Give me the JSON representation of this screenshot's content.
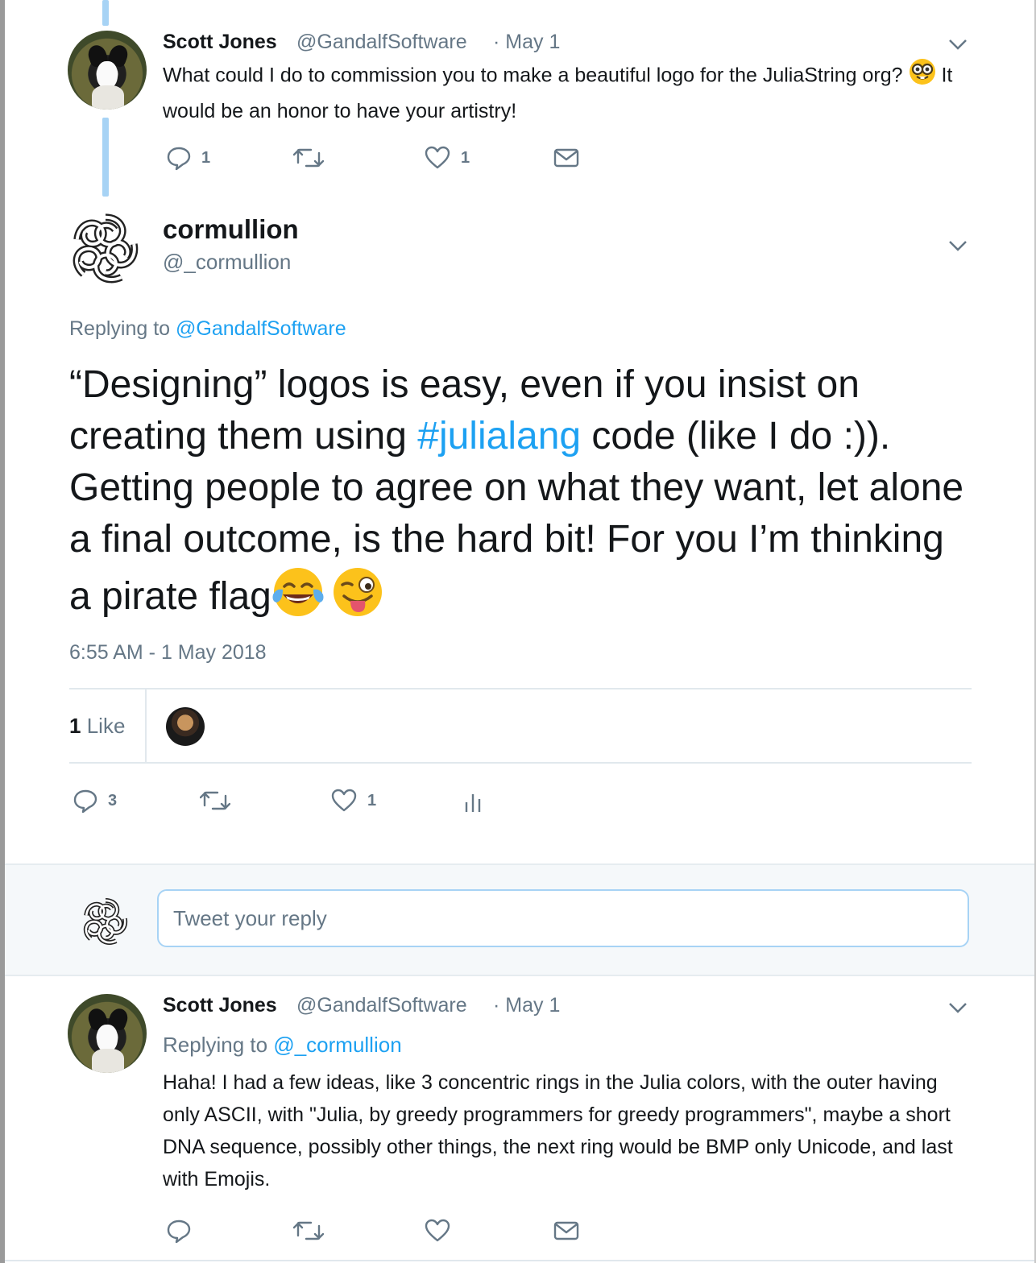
{
  "tweet1": {
    "name": "Scott Jones",
    "handle": "@GandalfSoftware",
    "date": "· May 1",
    "text_part1": "What could I do to commission you to make a beautiful logo for the JuliaString org?",
    "text_part2": "It would be an honor to have your artistry!",
    "reply_count": "1",
    "like_count": "1"
  },
  "main_tweet": {
    "name": "cormullion",
    "handle": "@_cormullion",
    "replying_label": "Replying to",
    "replying_handle": "@GandalfSoftware",
    "text_1": "“Designing” logos is easy, even if you insist on creating them using",
    "hashtag": "#julialang",
    "text_2": "code (like I do :)). Getting people to agree on what they want, let alone a final outcome, is the hard bit! For you I’m thinking a pirate flag",
    "timestamp": "6:55 AM - 1 May 2018",
    "likes_num": "1",
    "likes_label": "Like",
    "reply_count": "3",
    "like_count": "1"
  },
  "compose": {
    "placeholder": "Tweet your reply"
  },
  "tweet3": {
    "name": "Scott Jones",
    "handle": "@GandalfSoftware",
    "date": "· May 1",
    "replying_label": "Replying to",
    "replying_handle": "@_cormullion",
    "text": "Haha! I had a few ideas, like 3 concentric rings in the Julia colors, with the outer having only ASCII, with \"Julia, by greedy programmers for greedy programmers\", maybe a short DNA sequence, possibly other things, the next ring would be BMP only Unicode, and last with Emojis."
  },
  "colors": {
    "accent": "#1da1f2",
    "muted": "#657786",
    "thread_line": "#a7d3f5",
    "divider": "#e1e8ed",
    "compose_bg": "#f5f8fa"
  },
  "icons": [
    "reply-icon",
    "retweet-icon",
    "like-icon",
    "dm-icon",
    "analytics-icon",
    "chevron-down-icon",
    "nerd-face-emoji",
    "tears-of-joy-emoji",
    "winking-tongue-emoji",
    "cormullion-logo"
  ]
}
